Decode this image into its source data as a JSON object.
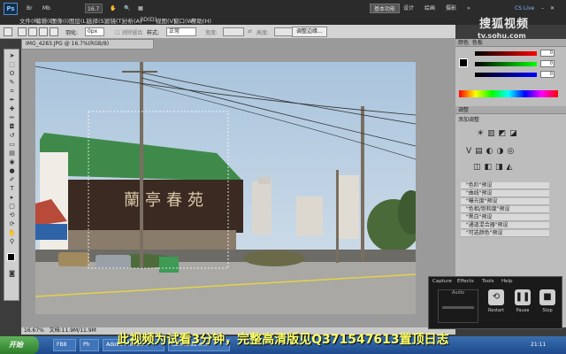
{
  "menubar": {
    "logo": "Ps",
    "items": [
      "文件(F)",
      "编辑(E)",
      "图像(I)",
      "图层(L)",
      "选择(S)",
      "滤镜(T)",
      "分析(A)",
      "3D(D)",
      "视图(V)",
      "窗口(W)",
      "帮助(H)"
    ],
    "zoom": "16.7",
    "workspaces": [
      "基本功能",
      "设计",
      "绘画",
      "摄影"
    ],
    "cs_live": "CS Live"
  },
  "watermark": {
    "logo": "搜狐视频",
    "url": "tv.sohu.com"
  },
  "options": {
    "feather_label": "羽化:",
    "feather_value": "0px",
    "style_label": "样式:",
    "style_value": "正常",
    "width_label": "宽度:",
    "height_label": "高度:",
    "refine_button": "调整边缘..."
  },
  "document": {
    "tab": "IMG_4283.JPG @ 16.7%(RGB/8)",
    "status_zoom": "16.67%",
    "status_doc": "文档:11.9M/11.9M",
    "sign_text": "蘭亭春苑"
  },
  "panels": {
    "color_tab": "颜色",
    "swatch_tab": "色板",
    "color_values": [
      "0",
      "0",
      "0"
    ],
    "adjust_tab": "调整",
    "adjust_title": "添加调整",
    "presets": [
      "\"色阶\"预设",
      "\"曲线\"预设",
      "\"曝光度\"预设",
      "\"色相/饱和度\"预设",
      "\"黑白\"预设",
      "\"通道混合器\"预设",
      "\"可选颜色\"预设"
    ]
  },
  "recorder": {
    "menu": [
      "Capture",
      "Effects",
      "Tools",
      "Help"
    ],
    "audio_label": "Audio",
    "buttons": [
      "Restart",
      "Pause",
      "Stop"
    ]
  },
  "subtitle": "此视频为试看3分钟，完整高清版见Q371547613置顶日志",
  "taskbar": {
    "start": "开始",
    "tasks": [
      "FB8",
      "Ph",
      "Adobe Photos...",
      "Camtasia Re..."
    ],
    "clock": "21:11"
  }
}
